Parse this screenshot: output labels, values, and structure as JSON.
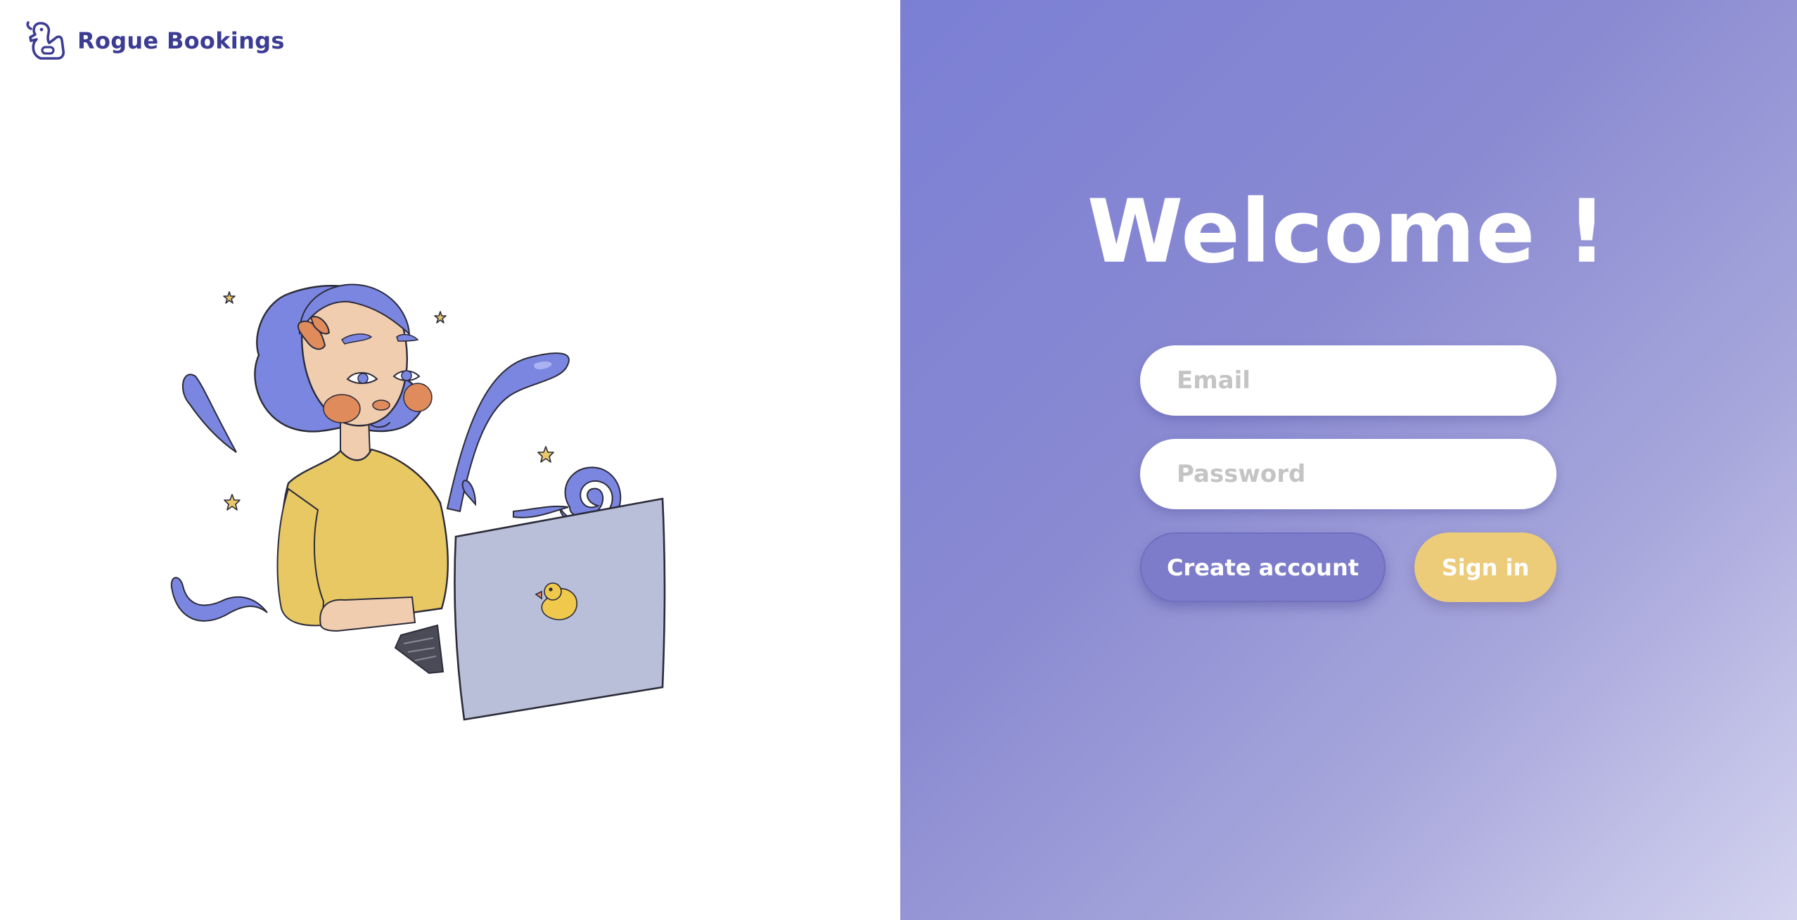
{
  "brand": {
    "name": "Rogue Bookings",
    "logo_icon": "rubber-duck-logo-icon"
  },
  "illustration": {
    "subject": "woman-with-laptop-illustration"
  },
  "login": {
    "heading": "Welcome !",
    "email_placeholder": "Email",
    "password_placeholder": "Password",
    "create_account_label": "Create account",
    "sign_in_label": "Sign in"
  },
  "colors": {
    "brand_text": "#3c3c94",
    "panel_gradient_start": "#7b7fd4",
    "panel_gradient_end": "#d4d3ef",
    "create_button": "#7c7cca",
    "sign_in_button": "#eccb79"
  }
}
